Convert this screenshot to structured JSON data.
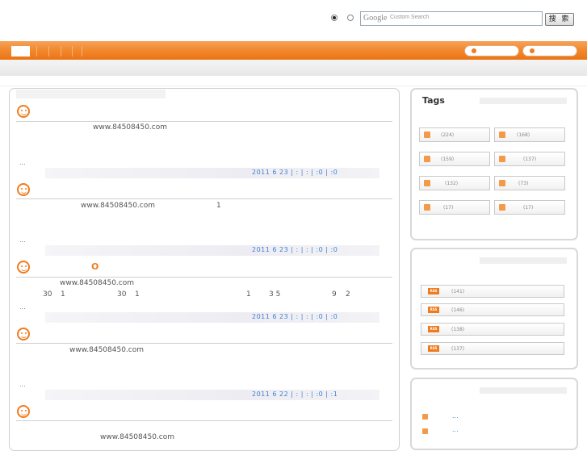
{
  "search": {
    "google_label": "Google",
    "placeholder": "Custom Search",
    "button_label": "搜 索"
  },
  "posts": [
    {
      "domain_text": "www.84508450.com",
      "extra": "",
      "ellipsis": "...",
      "meta": "2011 6 23 | :    | :   | :0 |  :0"
    },
    {
      "domain_text": "www.84508450.com",
      "extra": "1",
      "ellipsis": "...",
      "meta": "2011 6 23 | :    | :   | :0 |  :0"
    },
    {
      "title_char": "O",
      "domain_text": "www.84508450.com",
      "line2": [
        "30",
        "1",
        "30",
        "1",
        "1",
        "3 5",
        "9",
        "2"
      ],
      "ellipsis": "...",
      "meta": "2011 6 23 | :    | :   | :0 |  :0"
    },
    {
      "domain_text": "www.84508450.com",
      "ellipsis": "...",
      "meta": "2011 6 22 | :    | :   | :0 |  :1"
    },
    {
      "domain_text": "www.84508450.com"
    }
  ],
  "sidebar": {
    "tags_title": "Tags",
    "tags": [
      {
        "count": "(224)"
      },
      {
        "count": "(168)"
      },
      {
        "count": "(159)"
      },
      {
        "count": "(137)"
      },
      {
        "count": "(132)"
      },
      {
        "count": "(73)"
      },
      {
        "count": "(17)"
      },
      {
        "count": "(17)"
      }
    ],
    "rss": [
      {
        "badge": "RSS",
        "count": "(141)"
      },
      {
        "badge": "RSS",
        "count": "(146)"
      },
      {
        "badge": "RSS",
        "count": "(138)"
      },
      {
        "badge": "RSS",
        "count": "(137)"
      }
    ],
    "links": [
      {
        "text": "..."
      },
      {
        "text": "..."
      }
    ]
  },
  "colors": {
    "accent": "#f07b1e",
    "link": "#3f7fd2"
  }
}
